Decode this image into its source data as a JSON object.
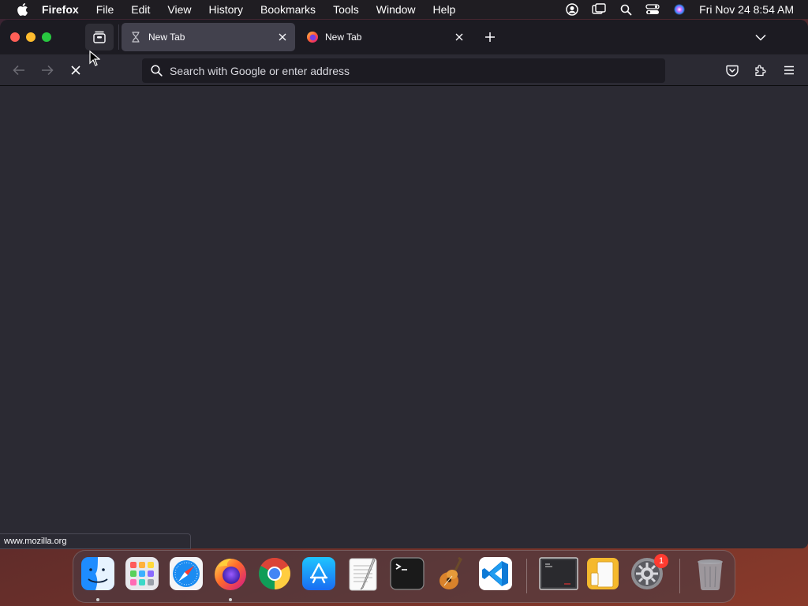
{
  "menubar": {
    "app_name": "Firefox",
    "items": [
      "File",
      "Edit",
      "View",
      "History",
      "Bookmarks",
      "Tools",
      "Window",
      "Help"
    ],
    "clock": "Fri Nov 24  8:54 AM"
  },
  "tabs": [
    {
      "title": "New Tab",
      "active": true,
      "icon": "hourglass-icon"
    },
    {
      "title": "New Tab",
      "active": false,
      "icon": "firefox-icon"
    }
  ],
  "urlbar": {
    "placeholder": "Search with Google or enter address",
    "value": ""
  },
  "statusbar": {
    "text": "www.mozilla.org"
  },
  "dock": {
    "apps": [
      "Finder",
      "Launchpad",
      "Safari",
      "Firefox",
      "Google Chrome",
      "App Store",
      "TextEdit",
      "Terminal",
      "GarageBand",
      "Visual Studio Code",
      "ZenTerm",
      "Preview",
      "System Settings",
      "Trash"
    ],
    "settings_badge": "1"
  },
  "colors": {
    "window_bg": "#2b2a33",
    "tabbar_bg": "#1c1b22",
    "active_tab": "#42414d",
    "urlbar_bg": "#1c1b22"
  }
}
